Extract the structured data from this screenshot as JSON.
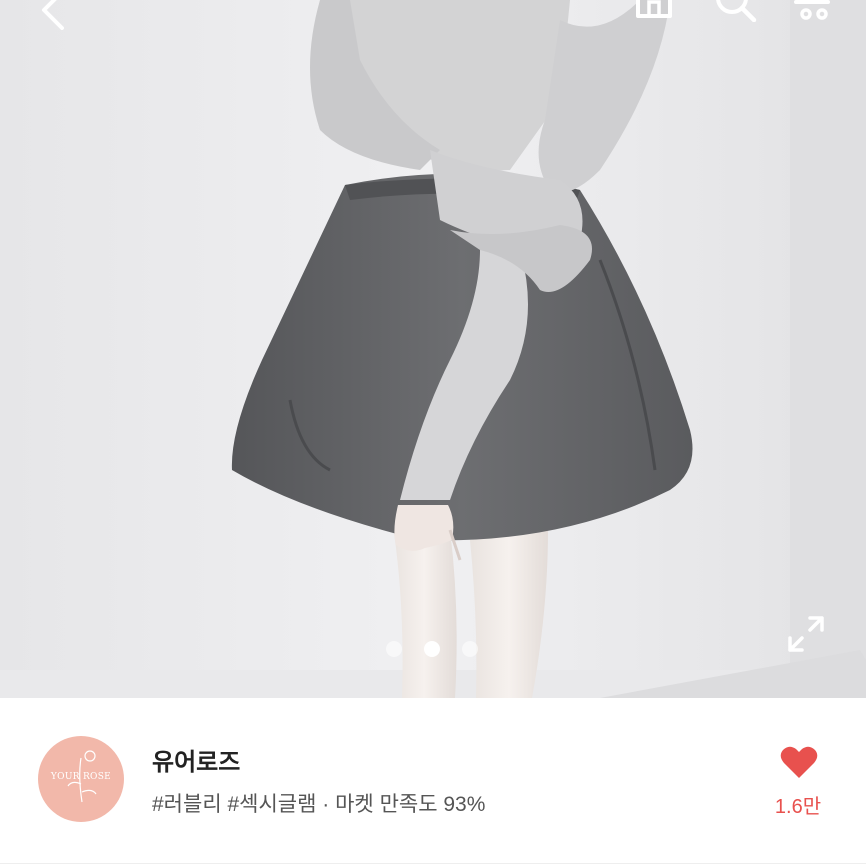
{
  "toolbar": {
    "back_icon": "chevron-left-icon",
    "home_icon": "home-icon",
    "search_icon": "search-icon",
    "cart_icon": "cart-icon"
  },
  "gallery": {
    "photo_subject": "product-photo",
    "page_count": 3,
    "active_page": 2,
    "expand_icon": "expand-icon"
  },
  "seller": {
    "avatar_text": "YOUR ROSE",
    "name": "유어로즈",
    "meta": "#러블리 #섹시글램 · 마켓 만족도 93%",
    "like_icon": "heart-icon",
    "like_count": "1.6만",
    "accent_color": "#e8514e"
  }
}
